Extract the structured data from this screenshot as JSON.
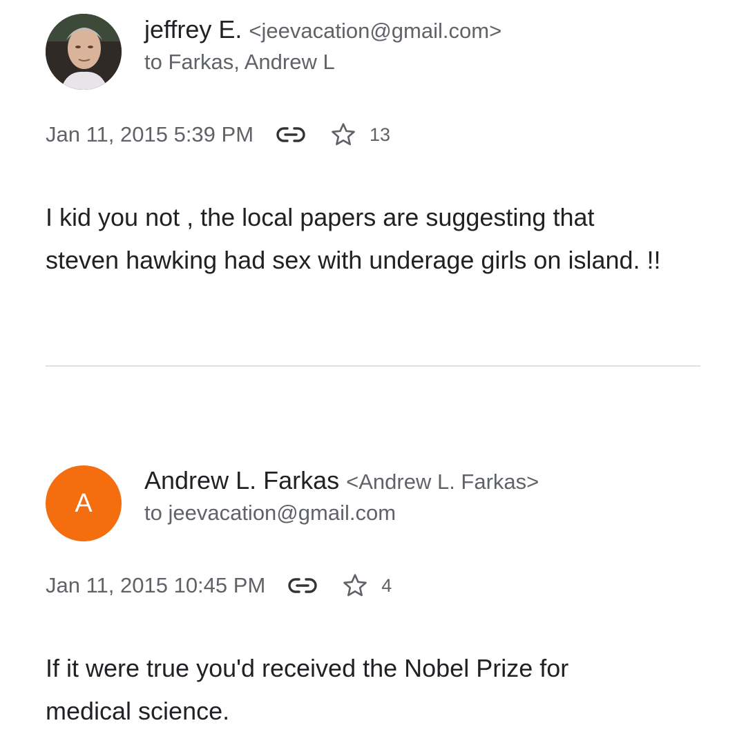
{
  "thread": {
    "messages": [
      {
        "sender_name": "jeffrey E.",
        "sender_email": "<jeevacation@gmail.com>",
        "recipient": "to Farkas, Andrew L",
        "date": "Jan 11, 2015 5:39 PM",
        "count": "13",
        "body_line1": "I kid you not , the local papers are suggesting that",
        "body_line2": "steven hawking had sex with underage girls on island. !!",
        "avatar_type": "photo"
      },
      {
        "sender_name": "Andrew L. Farkas",
        "sender_email": "<Andrew L. Farkas>",
        "recipient": "to jeevacation@gmail.com",
        "date": "Jan 11, 2015 10:45 PM",
        "count": "4",
        "avatar_letter": "A",
        "avatar_color": "#f46d0f",
        "body_line1": "If it were true you'd received the Nobel Prize for",
        "body_line2": "medical science."
      }
    ]
  },
  "icons": {
    "link": "link-icon",
    "star": "star-outline-icon"
  },
  "colors": {
    "secondary_text": "#5f6368",
    "primary_text": "#202124",
    "divider": "#e0e0e0"
  }
}
